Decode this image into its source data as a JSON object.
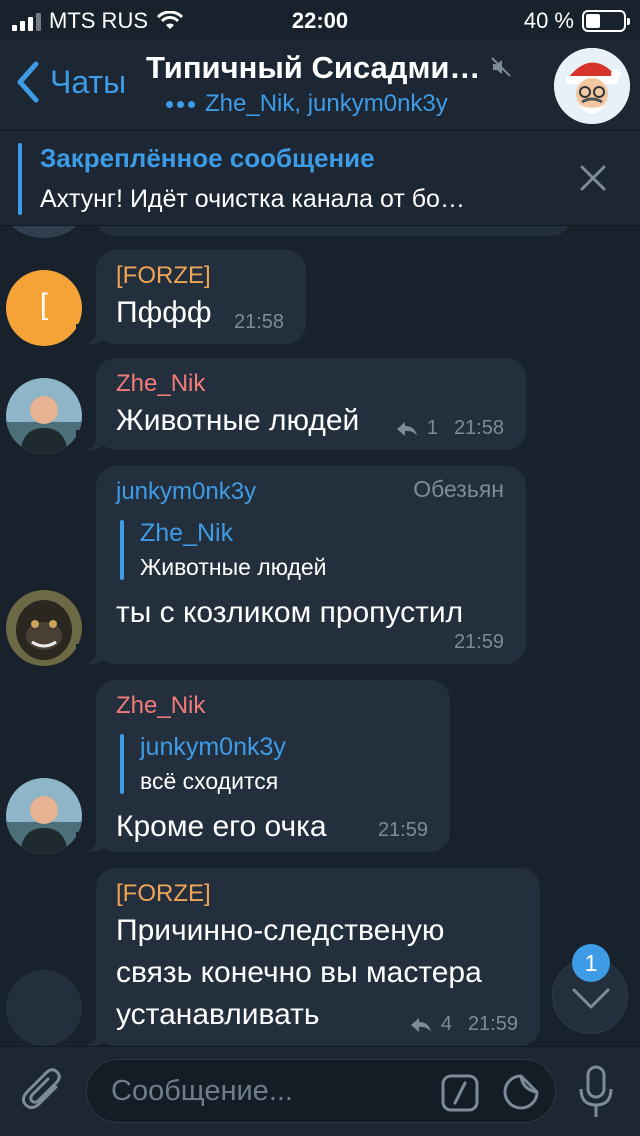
{
  "status_bar": {
    "carrier": "MTS RUS",
    "time": "22:00",
    "battery": "40 %",
    "battery_level": 0.4
  },
  "header": {
    "back_label": "Чаты",
    "title": "Типичный Сисадми…",
    "typing": "Zhe_Nik, junkym0nk3y"
  },
  "pinned": {
    "title": "Закреплённое сообщение",
    "text": "Ахтунг! Идёт очистка канала от бо…"
  },
  "messages": [
    {
      "sender": "[FORZE]",
      "avatar_letter": "[",
      "text": "Пффф",
      "time": "21:58"
    },
    {
      "sender": "Zhe_Nik",
      "text": "Животные людей",
      "replies": "1",
      "time": "21:58"
    },
    {
      "sender": "junkym0nk3y",
      "role": "Обезьян",
      "reply_to": {
        "name": "Zhe_Nik",
        "text": "Животные людей"
      },
      "text": "ты с козликом пропустил",
      "time": "21:59"
    },
    {
      "sender": "Zhe_Nik",
      "reply_to": {
        "name": "junkym0nk3y",
        "text": "всё сходится"
      },
      "text": "Кроме его очка",
      "time": "21:59"
    },
    {
      "sender": "[FORZE]",
      "text_lines": [
        "Причинно-следственую",
        "связь конечно вы мастера",
        "устанавливать"
      ],
      "replies": "4",
      "time": "21:59"
    }
  ],
  "scroll_down": {
    "unread": "1"
  },
  "composer": {
    "placeholder": "Сообщение..."
  },
  "colors": {
    "background": "#18222d",
    "bubble": "#232f3d",
    "accent": "#3e9be6",
    "forze": "#f0a555",
    "zhe_nik": "#f07b79"
  },
  "icons": [
    "attach-icon",
    "command-icon",
    "sticker-icon",
    "mic-icon",
    "mute-icon",
    "close-icon",
    "chevron-down-icon",
    "reply-arrow-icon",
    "back-chevron-icon"
  ]
}
